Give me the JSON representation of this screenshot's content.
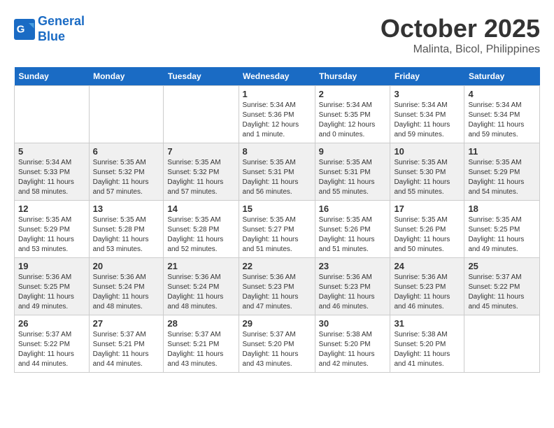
{
  "header": {
    "logo_line1": "General",
    "logo_line2": "Blue",
    "month": "October 2025",
    "location": "Malinta, Bicol, Philippines"
  },
  "weekdays": [
    "Sunday",
    "Monday",
    "Tuesday",
    "Wednesday",
    "Thursday",
    "Friday",
    "Saturday"
  ],
  "weeks": [
    [
      {
        "day": "",
        "info": ""
      },
      {
        "day": "",
        "info": ""
      },
      {
        "day": "",
        "info": ""
      },
      {
        "day": "1",
        "info": "Sunrise: 5:34 AM\nSunset: 5:36 PM\nDaylight: 12 hours\nand 1 minute."
      },
      {
        "day": "2",
        "info": "Sunrise: 5:34 AM\nSunset: 5:35 PM\nDaylight: 12 hours\nand 0 minutes."
      },
      {
        "day": "3",
        "info": "Sunrise: 5:34 AM\nSunset: 5:34 PM\nDaylight: 11 hours\nand 59 minutes."
      },
      {
        "day": "4",
        "info": "Sunrise: 5:34 AM\nSunset: 5:34 PM\nDaylight: 11 hours\nand 59 minutes."
      }
    ],
    [
      {
        "day": "5",
        "info": "Sunrise: 5:34 AM\nSunset: 5:33 PM\nDaylight: 11 hours\nand 58 minutes."
      },
      {
        "day": "6",
        "info": "Sunrise: 5:35 AM\nSunset: 5:32 PM\nDaylight: 11 hours\nand 57 minutes."
      },
      {
        "day": "7",
        "info": "Sunrise: 5:35 AM\nSunset: 5:32 PM\nDaylight: 11 hours\nand 57 minutes."
      },
      {
        "day": "8",
        "info": "Sunrise: 5:35 AM\nSunset: 5:31 PM\nDaylight: 11 hours\nand 56 minutes."
      },
      {
        "day": "9",
        "info": "Sunrise: 5:35 AM\nSunset: 5:31 PM\nDaylight: 11 hours\nand 55 minutes."
      },
      {
        "day": "10",
        "info": "Sunrise: 5:35 AM\nSunset: 5:30 PM\nDaylight: 11 hours\nand 55 minutes."
      },
      {
        "day": "11",
        "info": "Sunrise: 5:35 AM\nSunset: 5:29 PM\nDaylight: 11 hours\nand 54 minutes."
      }
    ],
    [
      {
        "day": "12",
        "info": "Sunrise: 5:35 AM\nSunset: 5:29 PM\nDaylight: 11 hours\nand 53 minutes."
      },
      {
        "day": "13",
        "info": "Sunrise: 5:35 AM\nSunset: 5:28 PM\nDaylight: 11 hours\nand 53 minutes."
      },
      {
        "day": "14",
        "info": "Sunrise: 5:35 AM\nSunset: 5:28 PM\nDaylight: 11 hours\nand 52 minutes."
      },
      {
        "day": "15",
        "info": "Sunrise: 5:35 AM\nSunset: 5:27 PM\nDaylight: 11 hours\nand 51 minutes."
      },
      {
        "day": "16",
        "info": "Sunrise: 5:35 AM\nSunset: 5:26 PM\nDaylight: 11 hours\nand 51 minutes."
      },
      {
        "day": "17",
        "info": "Sunrise: 5:35 AM\nSunset: 5:26 PM\nDaylight: 11 hours\nand 50 minutes."
      },
      {
        "day": "18",
        "info": "Sunrise: 5:35 AM\nSunset: 5:25 PM\nDaylight: 11 hours\nand 49 minutes."
      }
    ],
    [
      {
        "day": "19",
        "info": "Sunrise: 5:36 AM\nSunset: 5:25 PM\nDaylight: 11 hours\nand 49 minutes."
      },
      {
        "day": "20",
        "info": "Sunrise: 5:36 AM\nSunset: 5:24 PM\nDaylight: 11 hours\nand 48 minutes."
      },
      {
        "day": "21",
        "info": "Sunrise: 5:36 AM\nSunset: 5:24 PM\nDaylight: 11 hours\nand 48 minutes."
      },
      {
        "day": "22",
        "info": "Sunrise: 5:36 AM\nSunset: 5:23 PM\nDaylight: 11 hours\nand 47 minutes."
      },
      {
        "day": "23",
        "info": "Sunrise: 5:36 AM\nSunset: 5:23 PM\nDaylight: 11 hours\nand 46 minutes."
      },
      {
        "day": "24",
        "info": "Sunrise: 5:36 AM\nSunset: 5:23 PM\nDaylight: 11 hours\nand 46 minutes."
      },
      {
        "day": "25",
        "info": "Sunrise: 5:37 AM\nSunset: 5:22 PM\nDaylight: 11 hours\nand 45 minutes."
      }
    ],
    [
      {
        "day": "26",
        "info": "Sunrise: 5:37 AM\nSunset: 5:22 PM\nDaylight: 11 hours\nand 44 minutes."
      },
      {
        "day": "27",
        "info": "Sunrise: 5:37 AM\nSunset: 5:21 PM\nDaylight: 11 hours\nand 44 minutes."
      },
      {
        "day": "28",
        "info": "Sunrise: 5:37 AM\nSunset: 5:21 PM\nDaylight: 11 hours\nand 43 minutes."
      },
      {
        "day": "29",
        "info": "Sunrise: 5:37 AM\nSunset: 5:20 PM\nDaylight: 11 hours\nand 43 minutes."
      },
      {
        "day": "30",
        "info": "Sunrise: 5:38 AM\nSunset: 5:20 PM\nDaylight: 11 hours\nand 42 minutes."
      },
      {
        "day": "31",
        "info": "Sunrise: 5:38 AM\nSunset: 5:20 PM\nDaylight: 11 hours\nand 41 minutes."
      },
      {
        "day": "",
        "info": ""
      }
    ]
  ]
}
